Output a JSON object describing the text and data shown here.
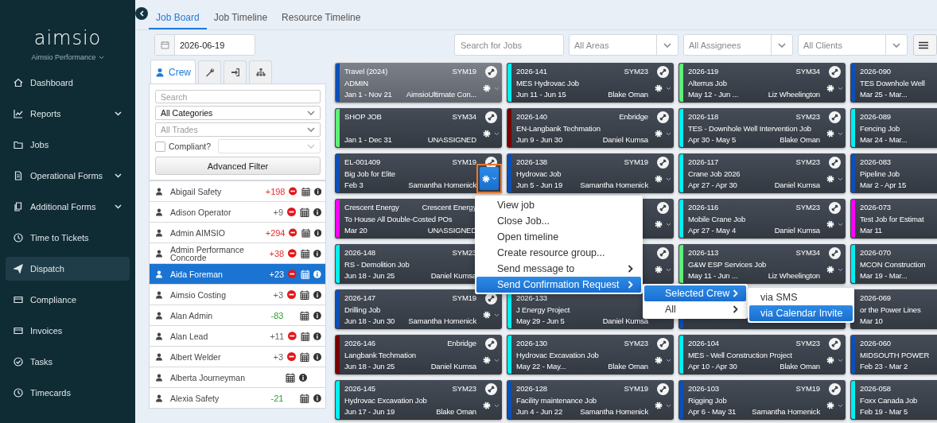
{
  "sidebar": {
    "logo": "aimsio",
    "account": "Aimsio Performance",
    "items": [
      {
        "label": "Dashboard",
        "expandable": false,
        "selected": false
      },
      {
        "label": "Reports",
        "expandable": true,
        "selected": false
      },
      {
        "label": "Jobs",
        "expandable": false,
        "selected": false
      },
      {
        "label": "Operational Forms",
        "expandable": true,
        "selected": false
      },
      {
        "label": "Additional Forms",
        "expandable": true,
        "selected": false
      },
      {
        "label": "Time to Tickets",
        "expandable": false,
        "selected": false
      },
      {
        "label": "Dispatch",
        "expandable": false,
        "selected": true
      },
      {
        "label": "Compliance",
        "expandable": false,
        "selected": false
      },
      {
        "label": "Invoices",
        "expandable": false,
        "selected": false
      },
      {
        "label": "Tasks",
        "expandable": false,
        "selected": false
      },
      {
        "label": "Timecards",
        "expandable": false,
        "selected": false
      }
    ]
  },
  "tabs": [
    {
      "label": "Job Board",
      "selected": true
    },
    {
      "label": "Job Timeline",
      "selected": false
    },
    {
      "label": "Resource Timeline",
      "selected": false
    }
  ],
  "filters": {
    "date": "2026-06-19",
    "search": {
      "placeholder": "Search for Jobs"
    },
    "selects": [
      "All Areas",
      "All Assignees",
      "All Clients"
    ]
  },
  "crew_panel": {
    "tabs": [
      {
        "kind": "crew",
        "label": "Crew",
        "selected": true
      },
      {
        "kind": "wrench",
        "selected": false
      },
      {
        "kind": "signin",
        "selected": false
      },
      {
        "kind": "sitemap",
        "selected": false
      }
    ],
    "search": {
      "placeholder": "Search"
    },
    "category": "All Categories",
    "trades": {
      "placeholder": "All Trades"
    },
    "compliant": {
      "label": "Compliant?",
      "checked": false
    },
    "advanced_filter": "Advanced Filter",
    "crew": [
      {
        "name": "Abigail Safety",
        "count": "+198",
        "color": "#e8302a",
        "blocked": true,
        "selected": false
      },
      {
        "name": "Adison Operator",
        "count": "+9",
        "color": "#666666",
        "blocked": true,
        "selected": false
      },
      {
        "name": "Admin AIMSIO",
        "count": "+294",
        "color": "#e8302a",
        "blocked": true,
        "selected": false
      },
      {
        "name": "Admin Performance Concorde",
        "count": "+38",
        "color": "#e8302a",
        "blocked": true,
        "selected": false
      },
      {
        "name": "Aida Foreman",
        "count": "+23",
        "color": "#ffffff",
        "blocked": true,
        "selected": true
      },
      {
        "name": "Aimsio Costing",
        "count": "+3",
        "color": "#666666",
        "blocked": true,
        "selected": false
      },
      {
        "name": "Alan Admin",
        "count": "-83",
        "color": "#2e9a2e",
        "blocked": false,
        "selected": false
      },
      {
        "name": "Alan Lead",
        "count": "+11",
        "color": "#666666",
        "blocked": true,
        "selected": false
      },
      {
        "name": "Albert Welder",
        "count": "+3",
        "color": "#666666",
        "blocked": true,
        "selected": false
      },
      {
        "name": "Alberta Journeyman",
        "blocked": false,
        "selected": false
      },
      {
        "name": "Alexia Safety",
        "count": "-21",
        "color": "#2e9a2e",
        "blocked": false,
        "selected": false
      }
    ]
  },
  "board": {
    "columns": [
      {
        "cards": [
          {
            "code": "Travel (2024)",
            "client": "SYM19",
            "title": "ADMIN",
            "dates": "Jan 1 - Nov 21",
            "assignee": "AimsioUltimate Con...",
            "color": "#0b4fb8",
            "muted": true,
            "menu_open": false
          },
          {
            "code": "SHOP JOB",
            "client": "SYM34",
            "dates": "Jan 1 - Dec 31",
            "assignee": "UNASSIGNED",
            "color": "#5ef07a",
            "muted": false,
            "menu_open": false
          },
          {
            "code": "EL-001409",
            "client": "SYM19",
            "title": "Big Job for Elite",
            "dates": "Feb 3",
            "assignee": "Samantha Homenick",
            "color": "#0b4fb8",
            "muted": false,
            "menu_open": true
          },
          {
            "code": "Crescent Energy",
            "client": "Crescent Energy",
            "title": "To House All Double-Costed POs",
            "dates": "Mar 20",
            "assignee": "UNASSIGNED",
            "color": "#ff00ff",
            "muted": false,
            "menu_open": false
          },
          {
            "code": "2026-148",
            "client": "SYM23",
            "title": "RS - Demolition Job",
            "dates": "Jun 18 - Jun 25",
            "assignee": "Daniel Kumsa",
            "color": "#00f0f0",
            "muted": false,
            "menu_open": false
          },
          {
            "code": "2026-147",
            "client": "SYM19",
            "title": "Drilling Job",
            "dates": "Jun 18 - Jun 30",
            "assignee": "Samantha Homenick",
            "color": "#0b4fb8",
            "muted": false,
            "menu_open": false
          },
          {
            "code": "2026-146",
            "client": "Enbridge",
            "title": "Langbank Techmation",
            "dates": "Jun 18 - Jun 25",
            "assignee": "Daniel Kumsa",
            "color": "#7a0000",
            "muted": false,
            "menu_open": false
          },
          {
            "code": "2026-145",
            "client": "SYM23",
            "title": "Hydrovac Excavation Job",
            "dates": "Jun 17 - Jun 19",
            "assignee": "Blake Oman",
            "color": "#00f0f0",
            "muted": false,
            "menu_open": false
          }
        ]
      },
      {
        "cards": [
          {
            "code": "2026-141",
            "client": "SYM23",
            "title": "MES Hydrovac Job",
            "dates": "Jun 11 - Jun 15",
            "assignee": "Blake Oman",
            "color": "#00f0f0",
            "muted": false,
            "menu_open": false
          },
          {
            "code": "2026-140",
            "client": "Enbridge",
            "title": "EN-Langbank Techmation",
            "dates": "Jun 9 - Jun 30",
            "assignee": "Daniel Kumsa",
            "color": "#7a0000",
            "muted": false,
            "menu_open": false
          },
          {
            "code": "2026-138",
            "client": "SYM19",
            "title": "Hydrovac Job",
            "dates": "Jun 5 - Jun 19",
            "assignee": "Samantha Homenick",
            "color": "#0b4fb8",
            "muted": false,
            "menu_open": false
          },
          {
            "muted": false,
            "menu_open": false
          },
          {
            "muted": false,
            "menu_open": false
          },
          {
            "code": "2026-133",
            "title": "J Energy Project",
            "dates": "May 29 - Jun 5",
            "assignee": "Daniel Kumsa",
            "color": "#00f0f0",
            "muted": false,
            "menu_open": false
          },
          {
            "code": "2026-130",
            "client": "SYM23",
            "title": "Hydrovac Excavation Job",
            "dates": "May 22 - May...",
            "assignee": "Blake Oman",
            "color": "#00f0f0",
            "muted": false,
            "menu_open": false
          },
          {
            "code": "2026-128",
            "client": "SYM19",
            "title": "Facility maintenance Job",
            "dates": "Jun 4 - Jun 22",
            "assignee": "Samantha Homenick",
            "color": "#0b4fb8",
            "muted": false,
            "menu_open": false
          }
        ]
      },
      {
        "cards": [
          {
            "code": "2026-119",
            "client": "SYM34",
            "title": "Alterrus Job",
            "dates": "May 12 - Jun ...",
            "assignee": "Liz Wheelington",
            "color": "#5ef07a",
            "muted": false,
            "menu_open": false
          },
          {
            "code": "2026-118",
            "client": "SYM23",
            "title": "TES - Downhole Well Intervention Job",
            "dates": "Apr 30 - May 5",
            "assignee": "Blake Oman",
            "color": "#00f0f0",
            "muted": false,
            "menu_open": false
          },
          {
            "code": "2026-117",
            "client": "SYM23",
            "title": "Crane Job 2026",
            "dates": "Apr 27 - Apr 30",
            "assignee": "Daniel Kumsa",
            "color": "#00f0f0",
            "muted": false,
            "menu_open": false
          },
          {
            "code": "2026-116",
            "client": "SYM23",
            "title": "Mobile Crane Job",
            "dates": "Apr 27 - May 4",
            "assignee": "Daniel Kumsa",
            "color": "#00f0f0",
            "muted": false,
            "menu_open": false
          },
          {
            "code": "2026-113",
            "client": "SYM34",
            "title": "G&W ESP Services Job",
            "dates": "May 11 - Jun ...",
            "assignee": "Liz Wheelington",
            "color": "#5ef07a",
            "muted": false,
            "menu_open": false
          },
          {
            "color": "#0b4fb8",
            "muted": false,
            "menu_open": false
          },
          {
            "code": "2026-104",
            "client": "SYM23",
            "title": "MES - Well Construction Project",
            "dates": "Apr 10 - Apr 30",
            "assignee": "Blake Oman",
            "color": "#00f0f0",
            "muted": false,
            "menu_open": false
          },
          {
            "code": "2026-103",
            "client": "SYM19",
            "title": "Rigging Job",
            "dates": "Apr 6 - May 31",
            "assignee": "Samantha Homenick",
            "color": "#0b4fb8",
            "muted": false,
            "menu_open": false
          }
        ]
      },
      {
        "cards": [
          {
            "code": "2026-090",
            "title": "TES Downhole Well",
            "dates": "Mar 25 - Mar...",
            "color": "#0b4fb8",
            "muted": false,
            "menu_open": false
          },
          {
            "code": "2026-089",
            "title": "Fencing Job",
            "dates": "Mar 24 - Mar...",
            "color": "#00f0f0",
            "muted": false,
            "menu_open": false
          },
          {
            "code": "2026-083",
            "title": "Pipeline Job",
            "dates": "Mar 2 - Apr 15",
            "color": "#0b4fb8",
            "muted": false,
            "menu_open": false
          },
          {
            "code": "2026-073",
            "title": "Test Job for Estimat",
            "dates": "Mar 11",
            "color": "#ff00ff",
            "muted": false,
            "menu_open": false
          },
          {
            "code": "2026-070",
            "title": "MCON Construction",
            "dates": "Mar 19 - Mar...",
            "color": "#00f0f0",
            "muted": false,
            "menu_open": false
          },
          {
            "code": "2026-069",
            "title": "or the Power Lines",
            "dates": "Mar 10",
            "muted": false,
            "menu_open": false
          },
          {
            "code": "2026-060",
            "title": "MIDSOUTH POWER",
            "dates": "Feb 23 - Mar 2",
            "color": "#0b4fb8",
            "muted": false,
            "menu_open": false
          },
          {
            "code": "2026-058",
            "title": "Foxx Canada Job",
            "dates": "Feb 19 - Mar 5",
            "color": "#00f0f0",
            "muted": false,
            "menu_open": false
          }
        ]
      }
    ]
  },
  "context_menu": {
    "items": [
      {
        "label": "View job",
        "submenu": false,
        "selected": false
      },
      {
        "label": "Close Job...",
        "submenu": false,
        "selected": false
      },
      {
        "label": "Open timeline",
        "submenu": false,
        "selected": false
      },
      {
        "label": "Create resource group...",
        "submenu": false,
        "selected": false
      },
      {
        "label": "Send message to",
        "submenu": true,
        "selected": false
      },
      {
        "label": "Send Confirmation Request",
        "submenu": true,
        "selected": true
      }
    ],
    "submenu": {
      "items": [
        {
          "label": "Selected Crew",
          "submenu": true,
          "selected": true
        },
        {
          "label": "All",
          "submenu": true,
          "selected": false
        }
      ]
    },
    "submenu_2": {
      "items": [
        {
          "label": "via SMS",
          "submenu": false,
          "selected": false
        },
        {
          "label": "via Calendar Invite",
          "submenu": false,
          "selected": true
        }
      ]
    }
  }
}
